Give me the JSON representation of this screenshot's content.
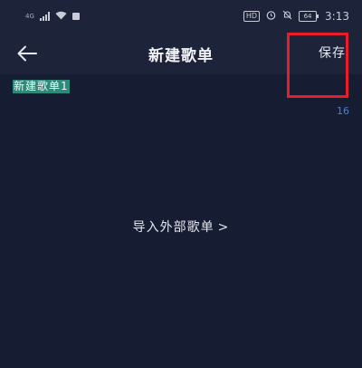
{
  "status_bar": {
    "signal_label": "4G",
    "time": "3:13",
    "hd_label": "HD",
    "battery_level": "64"
  },
  "nav": {
    "title": "新建歌单",
    "save_label": "保存"
  },
  "playlist_name": {
    "value": "新建歌单1",
    "char_count": "16"
  },
  "import": {
    "label": "导入外部歌单",
    "arrow": ">"
  },
  "colors": {
    "background": "#161c32",
    "highlight_border": "#e81c2a",
    "selection": "#2d8a79",
    "count_text": "#4f7fc9"
  }
}
